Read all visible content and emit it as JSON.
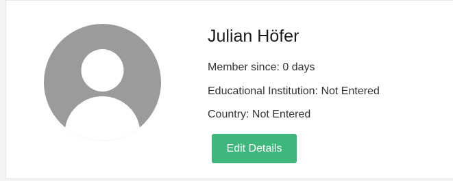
{
  "profile": {
    "avatar_icon": "user-avatar-icon",
    "name": "Julian Höfer",
    "member_since_label": "Member since:",
    "member_since_value": "0 days",
    "institution_label": "Educational Institution:",
    "institution_value": "Not Entered",
    "country_label": "Country:",
    "country_value": "Not Entered",
    "edit_button_label": "Edit Details"
  },
  "colors": {
    "accent": "#3fb77c",
    "avatar_gray": "#9b9b9b"
  }
}
